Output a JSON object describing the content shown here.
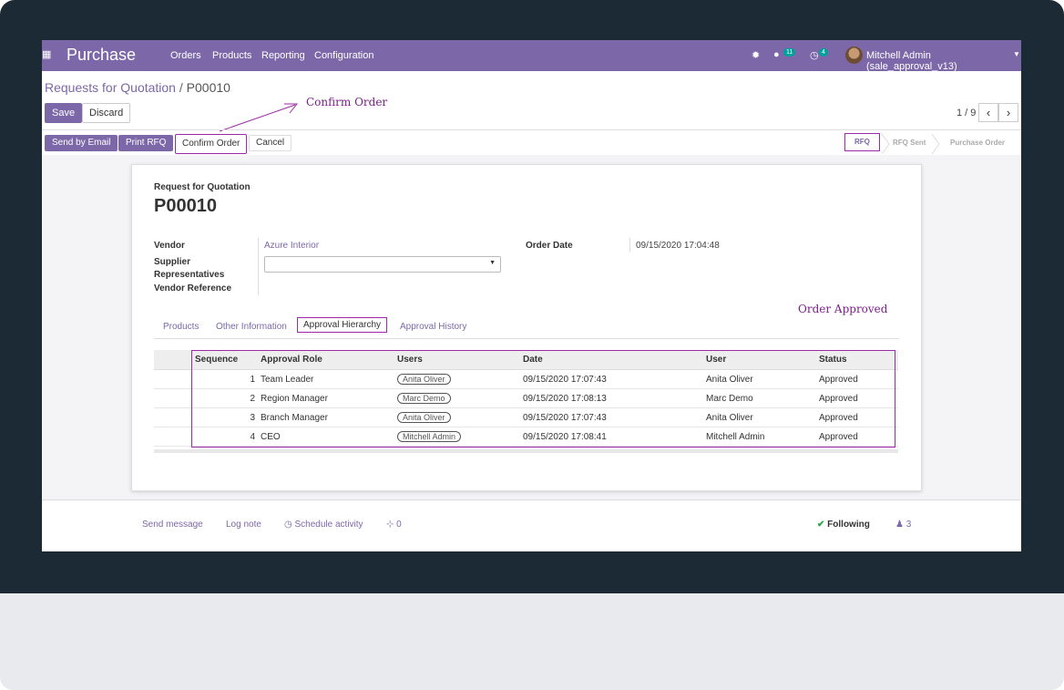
{
  "app": {
    "title": "Purchase",
    "menu": [
      "Orders",
      "Products",
      "Reporting",
      "Configuration"
    ],
    "messages_count": "11",
    "activities_count": "4",
    "user": "Mitchell Admin (sale_approval_v13)"
  },
  "breadcrumb": {
    "parent": "Requests for Quotation",
    "separator": "/",
    "current": "P00010"
  },
  "buttons": {
    "save": "Save",
    "discard": "Discard",
    "send_email": "Send by Email",
    "print_rfq": "Print RFQ",
    "confirm_order": "Confirm Order",
    "cancel": "Cancel"
  },
  "pager": {
    "value": "1 / 9"
  },
  "status_steps": [
    "RFQ",
    "RFQ Sent",
    "Purchase Order"
  ],
  "form": {
    "doc_type": "Request for Quotation",
    "name": "P00010",
    "vendor_label": "Vendor",
    "vendor": "Azure Interior",
    "supplier_reps_label": "Supplier Representatives",
    "supplier_reps_line1": "Supplier",
    "supplier_reps_line2": "Representatives",
    "vendor_ref_label": "Vendor Reference",
    "order_date_label": "Order Date",
    "order_date": "09/15/2020 17:04:48"
  },
  "tabs": [
    "Products",
    "Other Information",
    "Approval Hierarchy",
    "Approval History"
  ],
  "approval_table": {
    "columns": [
      "Sequence",
      "Approval Role",
      "Users",
      "Date",
      "User",
      "Status"
    ],
    "rows": [
      [
        "1",
        "Team Leader",
        "Anita Oliver",
        "09/15/2020 17:07:43",
        "Anita Oliver",
        "Approved"
      ],
      [
        "2",
        "Region Manager",
        "Marc Demo",
        "09/15/2020 17:08:13",
        "Marc Demo",
        "Approved"
      ],
      [
        "3",
        "Branch Manager",
        "Anita Oliver",
        "09/15/2020 17:07:43",
        "Anita Oliver",
        "Approved"
      ],
      [
        "4",
        "CEO",
        "Mitchell Admin",
        "09/15/2020 17:08:41",
        "Mitchell Admin",
        "Approved"
      ]
    ]
  },
  "annotations": {
    "confirm": "Confirm Order",
    "approved": "Order Approved"
  },
  "chatter": {
    "send_message": "Send message",
    "log_note": "Log note",
    "schedule_activity": "Schedule activity",
    "attachments": "0",
    "following": "Following",
    "followers": "3"
  },
  "colors": {
    "brand": "#7c68a8",
    "annotation": "#9c2aa6",
    "frame": "#1c2a35"
  }
}
